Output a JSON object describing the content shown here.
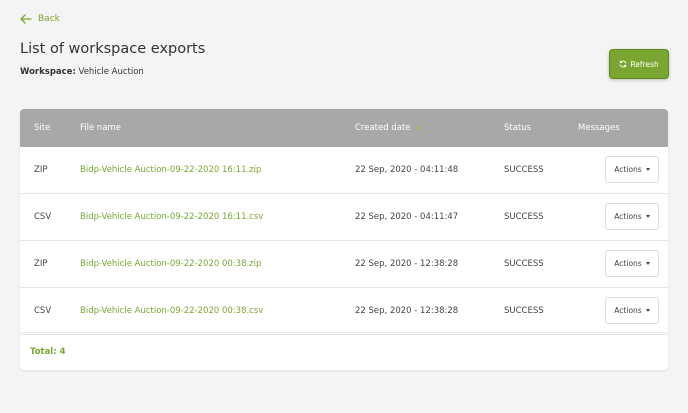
{
  "nav": {
    "back_label": "Back"
  },
  "header": {
    "title": "List of workspace exports",
    "workspace_label": "Workspace:",
    "workspace_name": "Vehicle Auction",
    "refresh_label": "Refresh"
  },
  "table": {
    "columns": [
      "Site",
      "File name",
      "Created date",
      "Status",
      "Messages"
    ],
    "rows": [
      {
        "site": "ZIP",
        "file": "Bidp-Vehicle Auction-09-22-2020 16:11.zip",
        "created": "22 Sep, 2020 - 04:11:48",
        "status": "SUCCESS",
        "action": "Actions"
      },
      {
        "site": "CSV",
        "file": "Bidp-Vehicle Auction-09-22-2020 16:11.csv",
        "created": "22 Sep, 2020 - 04:11:47",
        "status": "SUCCESS",
        "action": "Actions"
      },
      {
        "site": "ZIP",
        "file": "Bidp-Vehicle Auction-09-22-2020 00:38.zip",
        "created": "22 Sep, 2020 - 12:38:28",
        "status": "SUCCESS",
        "action": "Actions"
      },
      {
        "site": "CSV",
        "file": "Bidp-Vehicle Auction-09-22-2020 00:38.csv",
        "created": "22 Sep, 2020 - 12:38:28",
        "status": "SUCCESS",
        "action": "Actions"
      }
    ],
    "total": "Total: 4"
  },
  "colors": {
    "accent": "#7aa531",
    "header_bg": "#a8a8a8"
  }
}
